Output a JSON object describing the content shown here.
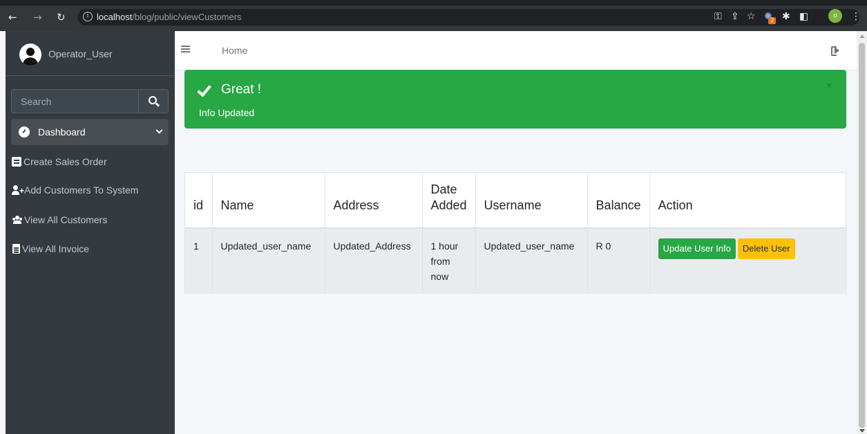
{
  "browser": {
    "url_host": "localhost",
    "url_path": "/blog/public/viewCustomers",
    "extension_badge": "2",
    "profile_initial": "o"
  },
  "sidebar": {
    "user_name": "Operator_User",
    "search_placeholder": "Search",
    "items": [
      {
        "label": "Dashboard",
        "icon": "tachometer-icon"
      },
      {
        "label": "Create Sales Order",
        "icon": "document-icon"
      },
      {
        "label": "Add Customers To System",
        "icon": "user-plus-icon"
      },
      {
        "label": "View All Customers",
        "icon": "users-icon"
      },
      {
        "label": "View All Invoice",
        "icon": "invoice-icon"
      }
    ]
  },
  "topbar": {
    "home_label": "Home"
  },
  "alert": {
    "title": "Great !",
    "message": "Info Updated",
    "close": "×",
    "color": "#28a745"
  },
  "table": {
    "headers": [
      "id",
      "Name",
      "Address",
      "Date Added",
      "Username",
      "Balance",
      "Action"
    ],
    "rows": [
      {
        "id": "1",
        "name": "Updated_user_name",
        "address": "Updated_Address",
        "date_added": "1 hour from now",
        "username": "Updated_user_name",
        "balance": "R 0",
        "update_label": "Update User Info",
        "delete_label": "Delete User"
      }
    ]
  },
  "colors": {
    "sidebar_bg": "#343a40",
    "success": "#28a745",
    "warning": "#ffc107"
  }
}
